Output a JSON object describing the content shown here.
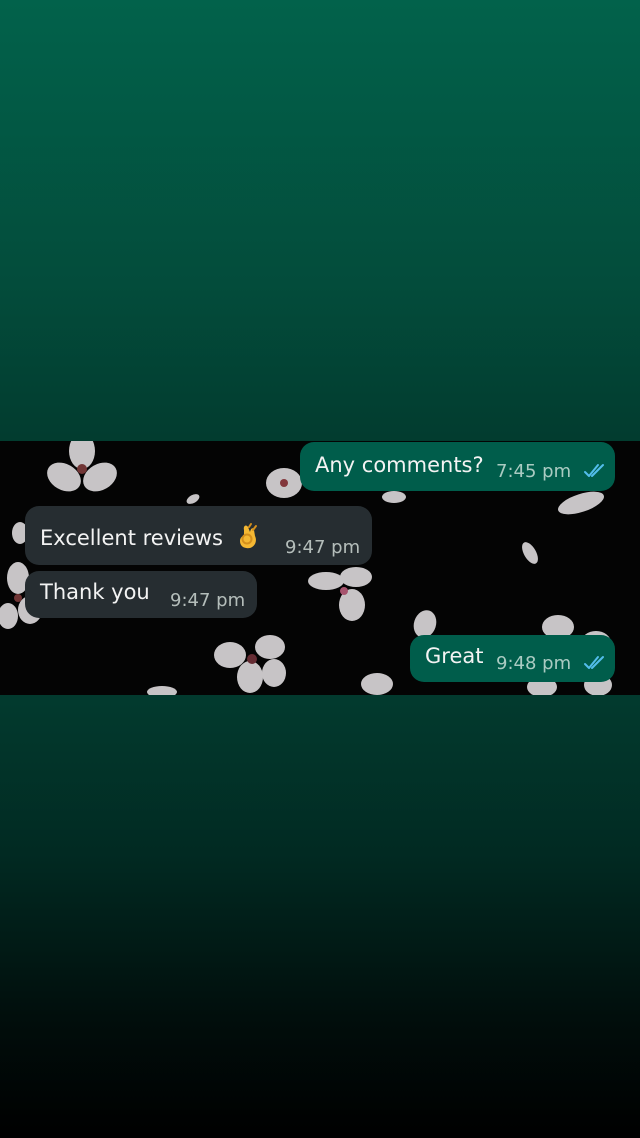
{
  "messages": [
    {
      "direction": "outgoing",
      "text": "Any comments?",
      "time": "7:45 pm",
      "status_icon": "double-check-icon"
    },
    {
      "direction": "incoming",
      "text": "Excellent reviews",
      "emoji_icon": "ok-hand-emoji-icon",
      "time": "9:47 pm"
    },
    {
      "direction": "incoming",
      "text": "Thank you",
      "time": "9:47 pm"
    },
    {
      "direction": "outgoing",
      "text": "Great",
      "time": "9:48 pm",
      "status_icon": "double-check-icon"
    }
  ],
  "colors": {
    "background_top": "#02624b",
    "background_bottom": "#000000",
    "incoming_bubble": "#262d31",
    "outgoing_bubble": "#005d4b",
    "read_receipt": "#53bdeb"
  }
}
